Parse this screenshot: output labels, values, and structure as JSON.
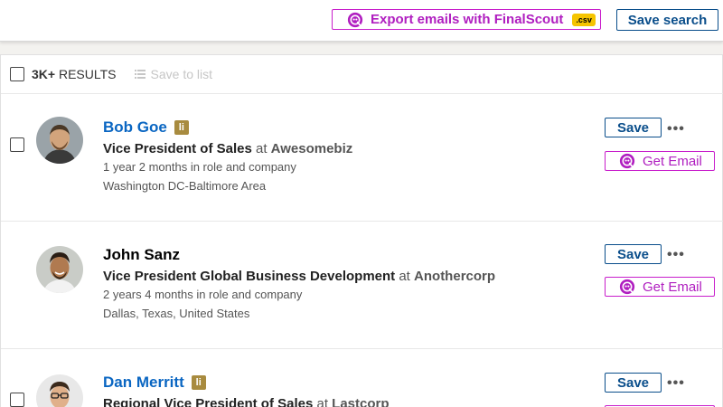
{
  "toolbar": {
    "export_label": "Export emails with FinalScout",
    "csv_badge": ".csv",
    "save_search_label": "Save search"
  },
  "results": {
    "count": "3K+",
    "label": "RESULTS",
    "save_to_list": "Save to list"
  },
  "people": [
    {
      "name": "Bob Goe",
      "title": "Vice President of Sales",
      "at": "at",
      "company": "Awesomebiz",
      "tenure": "1 year 2 months in role and company",
      "location": "Washington DC-Baltimore Area",
      "save_label": "Save",
      "more_label": "•••",
      "email_label": "Get Email"
    },
    {
      "name": "John Sanz",
      "title": "Vice President Global Business Development",
      "at": "at",
      "company": "Anothercorp",
      "tenure": "2 years 4 months in role and company",
      "location": "Dallas, Texas, United States",
      "save_label": "Save",
      "more_label": "•••",
      "email_label": "Get Email"
    },
    {
      "name": "Dan Merritt",
      "title": "Regional Vice President of Sales",
      "at": "at",
      "company": "Lastcorp",
      "save_label": "Save",
      "more_label": "•••"
    }
  ],
  "icons": {
    "linkedin": "li",
    "finalscout": "finalscout-icon"
  },
  "colors": {
    "brand_blue": "#0a66c2",
    "finalscout_magenta": "#c81ecb",
    "linkedin_badge": "#a88b3f",
    "csv_badge": "#f5c400"
  }
}
